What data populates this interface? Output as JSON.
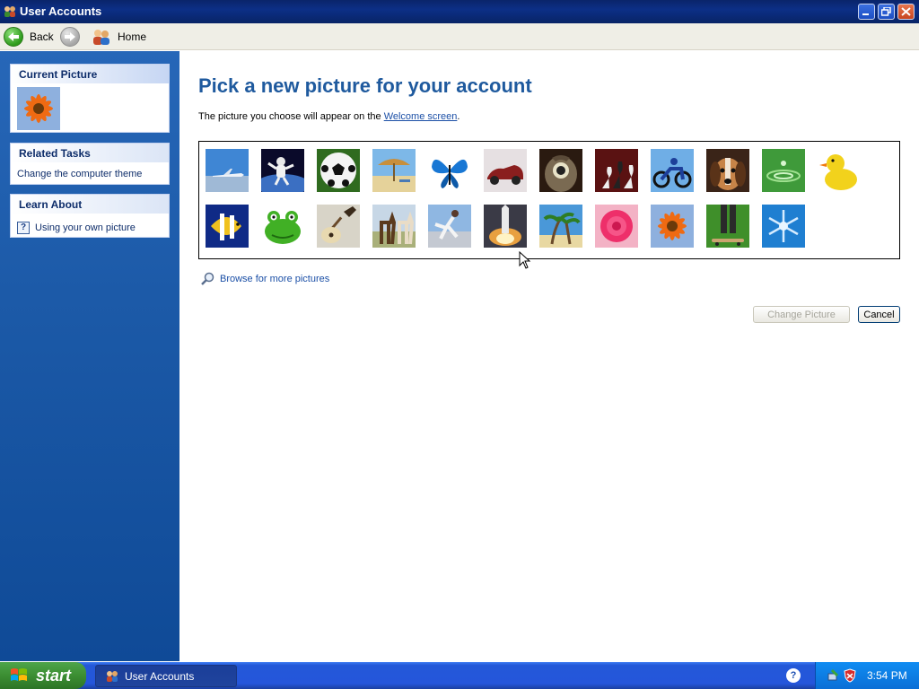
{
  "window": {
    "title": "User Accounts"
  },
  "toolbar": {
    "back_label": "Back",
    "home_label": "Home"
  },
  "sidebar": {
    "current_picture": {
      "header": "Current Picture"
    },
    "related_tasks": {
      "header": "Related Tasks",
      "items": [
        "Change the computer theme"
      ]
    },
    "learn_about": {
      "header": "Learn About",
      "items": [
        "Using your own picture"
      ]
    }
  },
  "main": {
    "heading": "Pick a new picture for your account",
    "subtext_prefix": "The picture you choose will appear on the ",
    "subtext_link": "Welcome screen",
    "subtext_suffix": ".",
    "pictures": [
      "airplane",
      "astronaut",
      "soccer-ball",
      "beach",
      "butterfly",
      "car",
      "owl",
      "chess",
      "motorcycle",
      "dog",
      "drip",
      "duck",
      "fish",
      "frog",
      "guitar",
      "horses",
      "kung-fu",
      "shuttle",
      "palm-trees",
      "rose",
      "flower",
      "skateboard",
      "snowflake"
    ],
    "browse_label": "Browse for more pictures",
    "change_picture_label": "Change Picture",
    "cancel_label": "Cancel"
  },
  "taskbar": {
    "start_label": "start",
    "task_label": "User Accounts",
    "clock": "3:54 PM"
  },
  "colors": {
    "heading": "#1f5a9e",
    "link": "#1b4fa6",
    "taskbar": "#2556db",
    "start": "#3c8e32"
  }
}
